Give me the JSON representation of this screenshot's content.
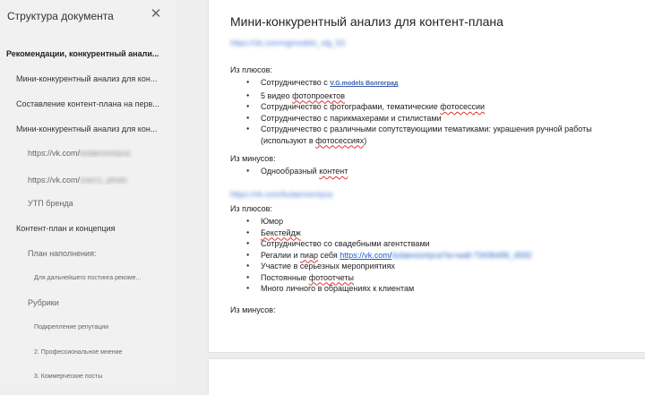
{
  "outline": {
    "title": "Структура документа",
    "close_icon": "close-icon",
    "items": [
      {
        "label": "Рекомендации, конкурентный анали...",
        "level": 1
      },
      {
        "label": "Мини-конкурентный анализ для кон...",
        "level": 2
      },
      {
        "label": "Составление контент-плана на перв...",
        "level": 2
      },
      {
        "label": "Мини-конкурентный анализ для кон...",
        "level": 2
      },
      {
        "label": "https://vk.com/",
        "label_hidden": "bulaevoortyca",
        "level": 3
      },
      {
        "label": "https://vk.com/",
        "label_hidden": "marc1_photo",
        "level": 3
      },
      {
        "label": "УТП бренда",
        "level": 3
      },
      {
        "label": "Контент-план и концепция",
        "level": 2
      },
      {
        "label": "План наполнения:",
        "level": 3
      },
      {
        "label": "Для дальнейшего постинга рекоме...",
        "level": 4
      },
      {
        "label": "Рубрики",
        "level": 3
      },
      {
        "label": "Подкрепление репутации",
        "level": 4
      },
      {
        "label": "2. Профессиональное мнение",
        "level": 4
      },
      {
        "label": "3. Коммерческие посты",
        "level": 4
      }
    ]
  },
  "document": {
    "title": "Мини-конкурентный анализ для контент-плана",
    "link1": "https://vk.com/vgmodels_vlg_53",
    "section1": {
      "plus_label": "Из плюсов:",
      "item1_prefix": "Сотрудничество с ",
      "item1_link": "V.G.models Волгоград",
      "item2_prefix": "5 видео ",
      "item2_word": "фотопроектов",
      "item3_prefix": "Сотрудничество с фотографами, тематические ",
      "item3_word": "фотосессии",
      "item4": "Сотрудничество с парикмахерами и стилистами",
      "item5_text": "Сотрудничество с различными сопутствующими тематиками: украшения ручной работы (используют в ",
      "item5_word": "фотосессиях",
      "item5_suffix": ")",
      "minus_label": "Из минусов:",
      "minus1_prefix": "Однообразный ",
      "minus1_word": "контент"
    },
    "link2": "https://vk.com/bulaevoortyca",
    "section2": {
      "plus_label": "Из плюсов:",
      "item1": "Юмор",
      "item2_word": "Бекстейдж",
      "item3": "Сотрудничество со свадебными агентствами",
      "item4_prefix": "Регалии и ",
      "item4_word": "пиар",
      "item4_middle": " себя ",
      "item4_link": "https://vk.com/",
      "item4_link_hidden": "bulaevoortyca?w=wall-73436496_4592",
      "item5": "Участие в серьезных мероприятиях",
      "item6_prefix": "Постоянные ",
      "item6_word": "фотоотчеты",
      "item7": "Много личного в обращениях к клиентам",
      "minus_label": "Из минусов:"
    }
  }
}
